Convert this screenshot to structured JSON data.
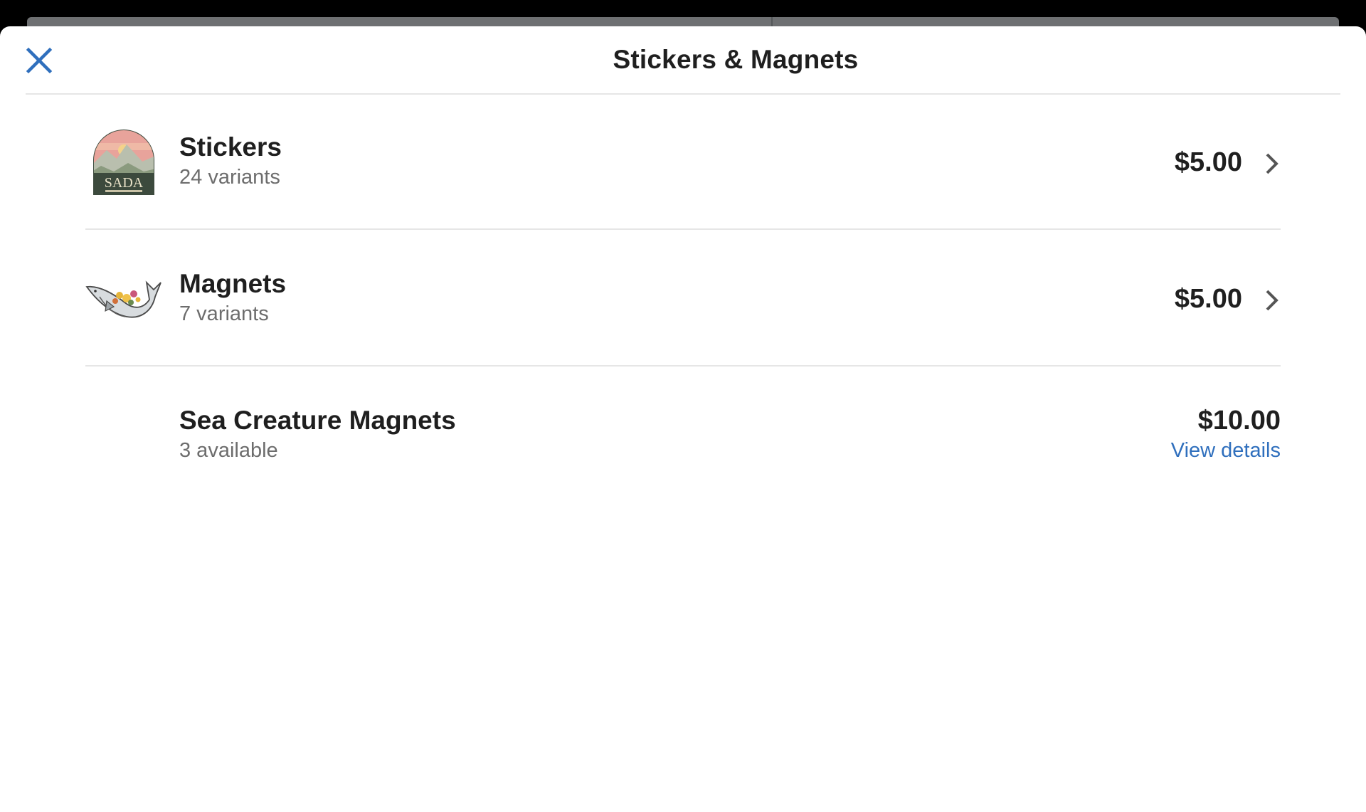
{
  "header": {
    "title": "Stickers & Magnets"
  },
  "colors": {
    "accent": "#2f6fbd",
    "text": "#1f1f1f",
    "muted": "#6d6d6d",
    "divider": "#e6e6e6"
  },
  "items": [
    {
      "name": "Stickers",
      "subtitle": "24 variants",
      "price": "$5.00",
      "thumbnail": "mountain-sticker-thumbnail",
      "thumbnail_text": "SADA",
      "action_icon": "chevron-right-icon"
    },
    {
      "name": "Magnets",
      "subtitle": "7 variants",
      "price": "$5.00",
      "thumbnail": "whale-magnet-thumbnail",
      "action_icon": "chevron-right-icon"
    },
    {
      "name": "Sea Creature Magnets",
      "subtitle": "3 available",
      "price": "$10.00",
      "action_label": "View details"
    }
  ]
}
